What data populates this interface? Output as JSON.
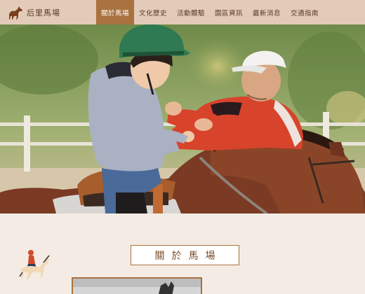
{
  "brand": {
    "name": "后里馬場",
    "logo_icon": "horse-logo-icon"
  },
  "nav": {
    "items": [
      {
        "label": "關於馬場",
        "active": true
      },
      {
        "label": "文化歷史",
        "active": false
      },
      {
        "label": "活動體驗",
        "active": false
      },
      {
        "label": "園區資訊",
        "active": false
      },
      {
        "label": "最新消息",
        "active": false
      },
      {
        "label": "交通指南",
        "active": false
      }
    ]
  },
  "hero": {
    "image": "child-on-pony-with-instructor-photo"
  },
  "about": {
    "title": "關於馬場",
    "icon": "equestrian-rider-icon"
  },
  "colors": {
    "nav_bg": "#e2cbb9",
    "accent": "#a9723e",
    "page_bg": "#f4ece4"
  }
}
